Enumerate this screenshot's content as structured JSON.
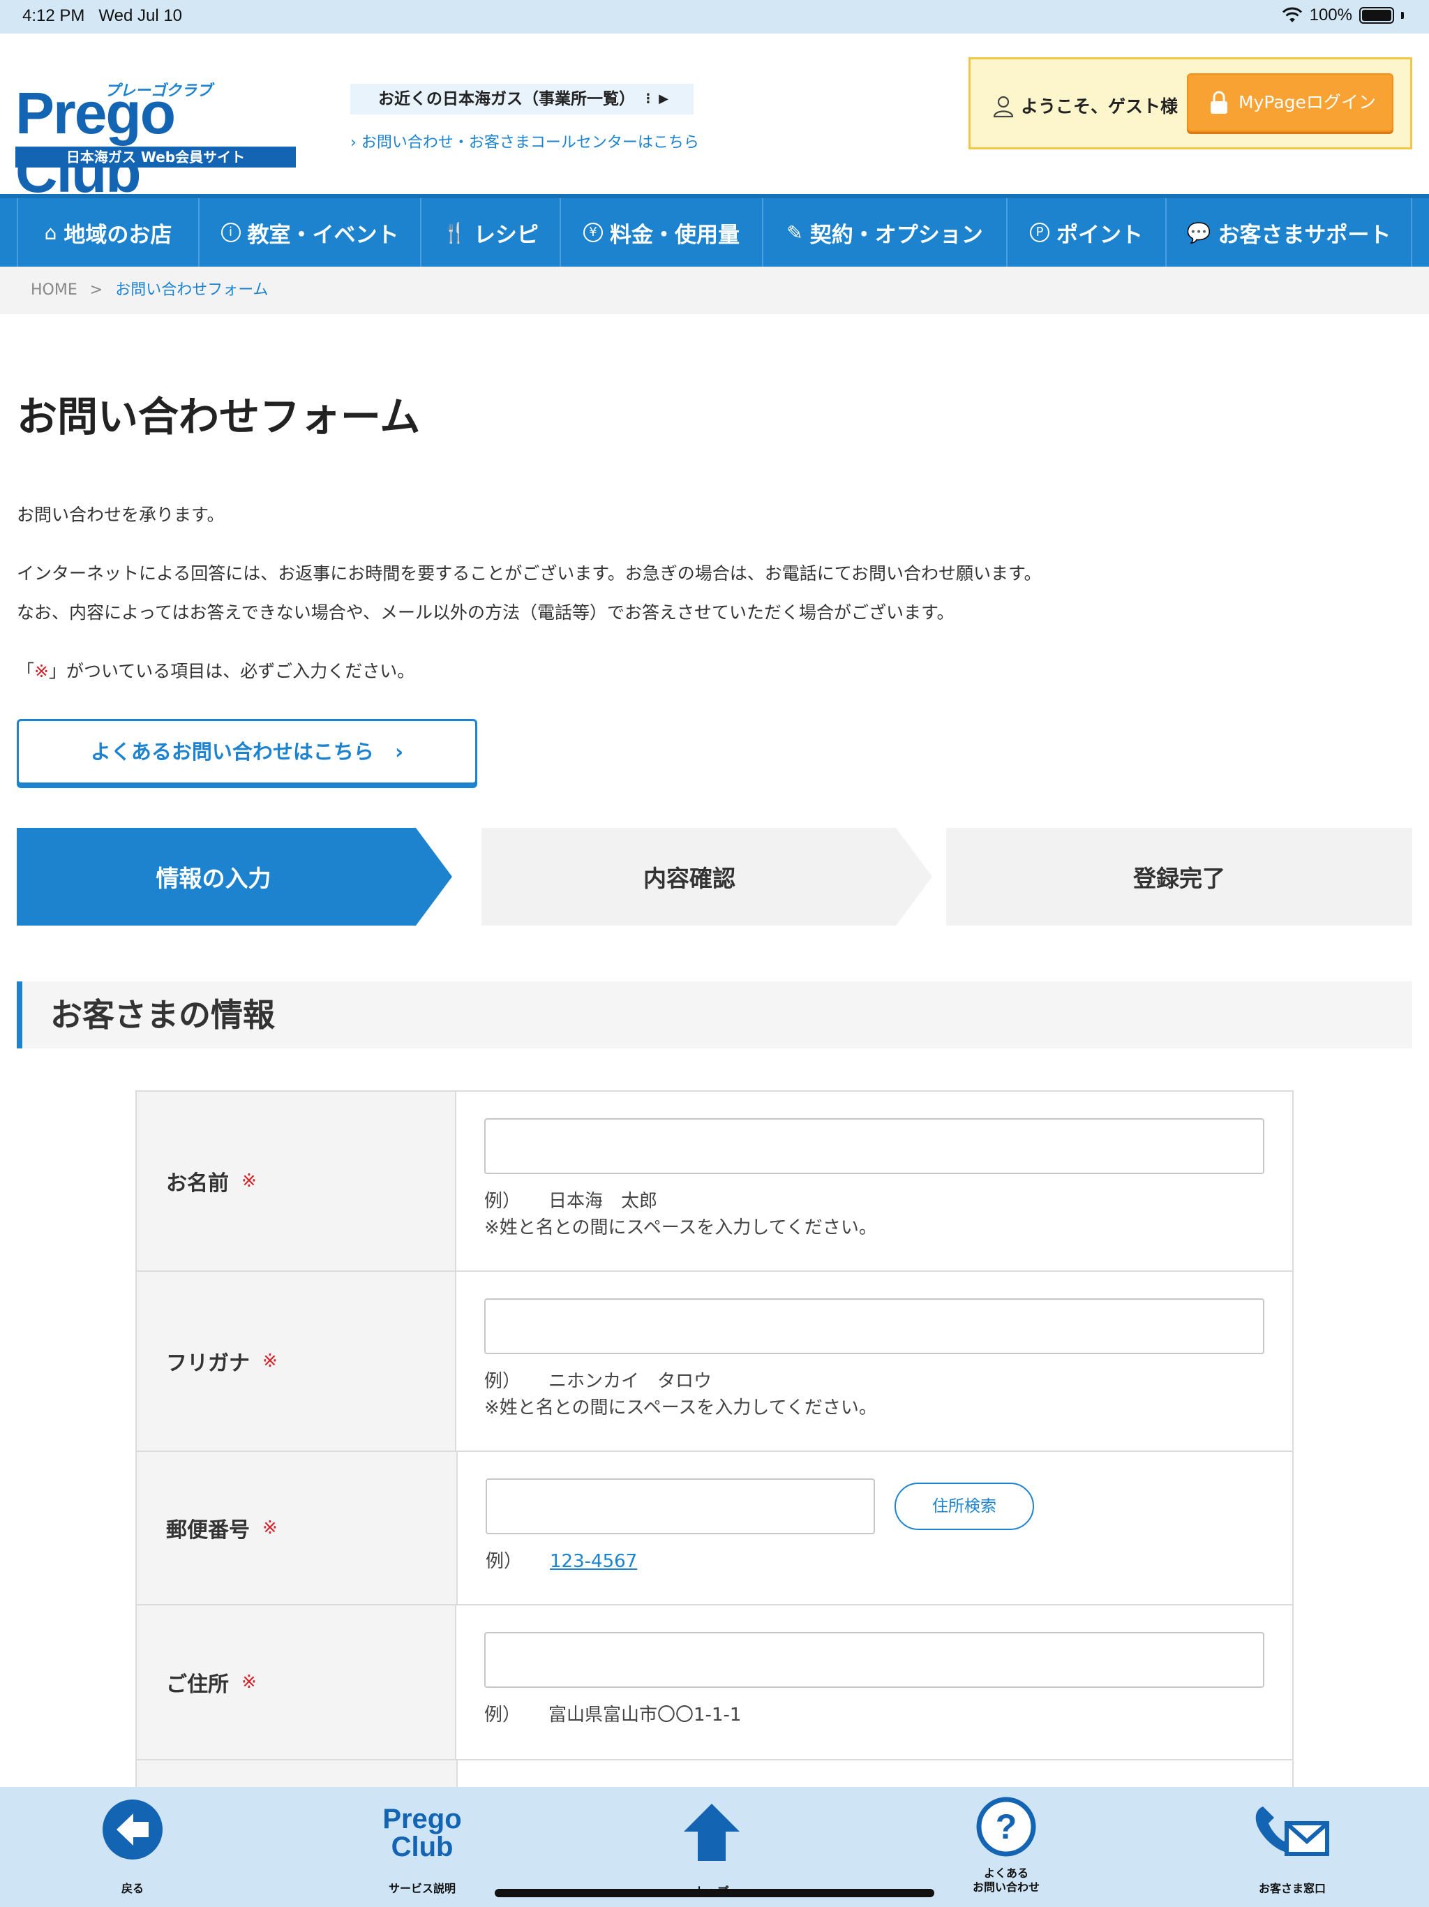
{
  "status_bar": {
    "time": "4:12 PM",
    "date": "Wed Jul 10",
    "battery": "100%"
  },
  "header": {
    "logo_kana": "プレーゴクラブ",
    "logo_word": "Prego Club",
    "logo_sub": "日本海ガス Web会員サイト",
    "office_link": "お近くの日本海ガス（事業所一覧）",
    "callcenter_link": "お問い合わせ・お客さまコールセンターはこちら",
    "welcome": "ようこそ、ゲスト様",
    "login_button": "MyPageログイン"
  },
  "nav": {
    "items": [
      {
        "label": "地域のお店",
        "icon": "shop-icon"
      },
      {
        "label": "教室・イベント",
        "icon": "info-icon"
      },
      {
        "label": "レシピ",
        "icon": "cutlery-icon"
      },
      {
        "label": "料金・使用量",
        "icon": "yen-icon"
      },
      {
        "label": "契約・オプション",
        "icon": "edit-icon"
      },
      {
        "label": "ポイント",
        "icon": "point-icon"
      },
      {
        "label": "お客さまサポート",
        "icon": "chat-icon"
      }
    ]
  },
  "breadcrumb": {
    "home": "HOME",
    "separator": ">",
    "current": "お問い合わせフォーム"
  },
  "page": {
    "title": "お問い合わせフォーム",
    "intro1": "お問い合わせを承ります。",
    "intro2": "インターネットによる回答には、お返事にお時間を要することがございます。お急ぎの場合は、お電話にてお問い合わせ願います。",
    "intro3": "なお、内容によってはお答えできない場合や、メール以外の方法（電話等）でお答えさせていただく場合がございます。",
    "required_note_pre": "「",
    "required_mark": "※",
    "required_note_post": "」がついている項目は、必ずご入力ください。",
    "faq_button": "よくあるお問い合わせはこちら"
  },
  "steps": [
    {
      "label": "情報の入力",
      "active": true
    },
    {
      "label": "内容確認",
      "active": false
    },
    {
      "label": "登録完了",
      "active": false
    }
  ],
  "section_title": "お客さまの情報",
  "form": {
    "required_mark": "※",
    "example_prefix": "例）",
    "name": {
      "label": "お名前",
      "example": "日本海　太郎",
      "note": "※姓と名との間にスペースを入力してください。",
      "value": ""
    },
    "furigana": {
      "label": "フリガナ",
      "example": "ニホンカイ　タロウ",
      "note": "※姓と名との間にスペースを入力してください。",
      "value": ""
    },
    "postal": {
      "label": "郵便番号",
      "example": "123-4567",
      "search_button": "住所検索",
      "value": ""
    },
    "address": {
      "label": "ご住所",
      "example": "富山県富山市〇〇1-1-1",
      "value": ""
    }
  },
  "toolbar": {
    "back": "戻る",
    "service_logo_1": "Prego",
    "service_logo_2": "Club",
    "service": "サービス説明",
    "top": "トップ",
    "faq_line1": "よくある",
    "faq_line2": "お問い合わせ",
    "contact": "お客さま窓口"
  },
  "colors": {
    "primary": "#1d83cf",
    "orange": "#f7a233",
    "required": "#d4242b",
    "toolbar_bg": "#cfe5f5"
  }
}
